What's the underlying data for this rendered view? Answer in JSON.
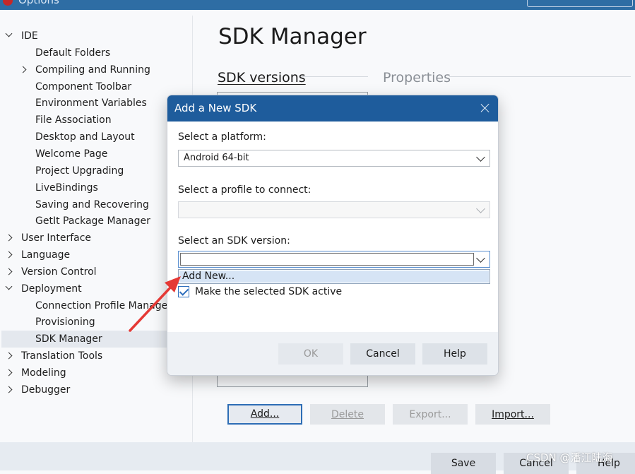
{
  "window": {
    "title": "Options"
  },
  "tree": {
    "items": [
      {
        "label": "IDE",
        "level": 0,
        "state": "expanded"
      },
      {
        "label": "Default Folders",
        "level": 1,
        "state": "leaf"
      },
      {
        "label": "Compiling and Running",
        "level": 1,
        "state": "collapsed"
      },
      {
        "label": "Component Toolbar",
        "level": 1,
        "state": "leaf"
      },
      {
        "label": "Environment Variables",
        "level": 1,
        "state": "leaf"
      },
      {
        "label": "File Association",
        "level": 1,
        "state": "leaf"
      },
      {
        "label": "Desktop and Layout",
        "level": 1,
        "state": "leaf"
      },
      {
        "label": "Welcome Page",
        "level": 1,
        "state": "leaf"
      },
      {
        "label": "Project Upgrading",
        "level": 1,
        "state": "leaf"
      },
      {
        "label": "LiveBindings",
        "level": 1,
        "state": "leaf"
      },
      {
        "label": "Saving and Recovering",
        "level": 1,
        "state": "leaf"
      },
      {
        "label": "GetIt Package Manager",
        "level": 1,
        "state": "leaf"
      },
      {
        "label": "User Interface",
        "level": 0,
        "state": "collapsed"
      },
      {
        "label": "Language",
        "level": 0,
        "state": "collapsed"
      },
      {
        "label": "Version Control",
        "level": 0,
        "state": "collapsed"
      },
      {
        "label": "Deployment",
        "level": 0,
        "state": "expanded"
      },
      {
        "label": "Connection Profile Manager",
        "level": 1,
        "state": "leaf"
      },
      {
        "label": "Provisioning",
        "level": 1,
        "state": "leaf"
      },
      {
        "label": "SDK Manager",
        "level": 1,
        "state": "leaf",
        "selected": true
      },
      {
        "label": "Translation Tools",
        "level": 0,
        "state": "collapsed"
      },
      {
        "label": "Modeling",
        "level": 0,
        "state": "collapsed"
      },
      {
        "label": "Debugger",
        "level": 0,
        "state": "collapsed"
      }
    ]
  },
  "main": {
    "title": "SDK Manager",
    "tabs": [
      {
        "label": "SDK versions",
        "active": true
      },
      {
        "label": "Properties",
        "active": false
      }
    ],
    "buttons": {
      "add": "Add...",
      "delete": "Delete",
      "export": "Export...",
      "import": "Import..."
    }
  },
  "dialog": {
    "title": "Add a New SDK",
    "platform_label": "Select a platform:",
    "platform_value": "Android 64-bit",
    "profile_label": "Select a profile to connect:",
    "profile_value": "",
    "sdk_label": "Select an SDK version:",
    "sdk_value": "",
    "dropdown_option": "Add New...",
    "checkbox_label": "Make the selected SDK active",
    "checkbox_checked": true,
    "ok": "OK",
    "cancel": "Cancel",
    "help": "Help"
  },
  "footer": {
    "save": "Save",
    "cancel": "Cancel",
    "help": "Help"
  },
  "watermark": "CSDN @潘江陆海",
  "colors": {
    "dialog_header": "#1e5c9c",
    "accent": "#2d6db5",
    "arrow": "#e53935"
  }
}
